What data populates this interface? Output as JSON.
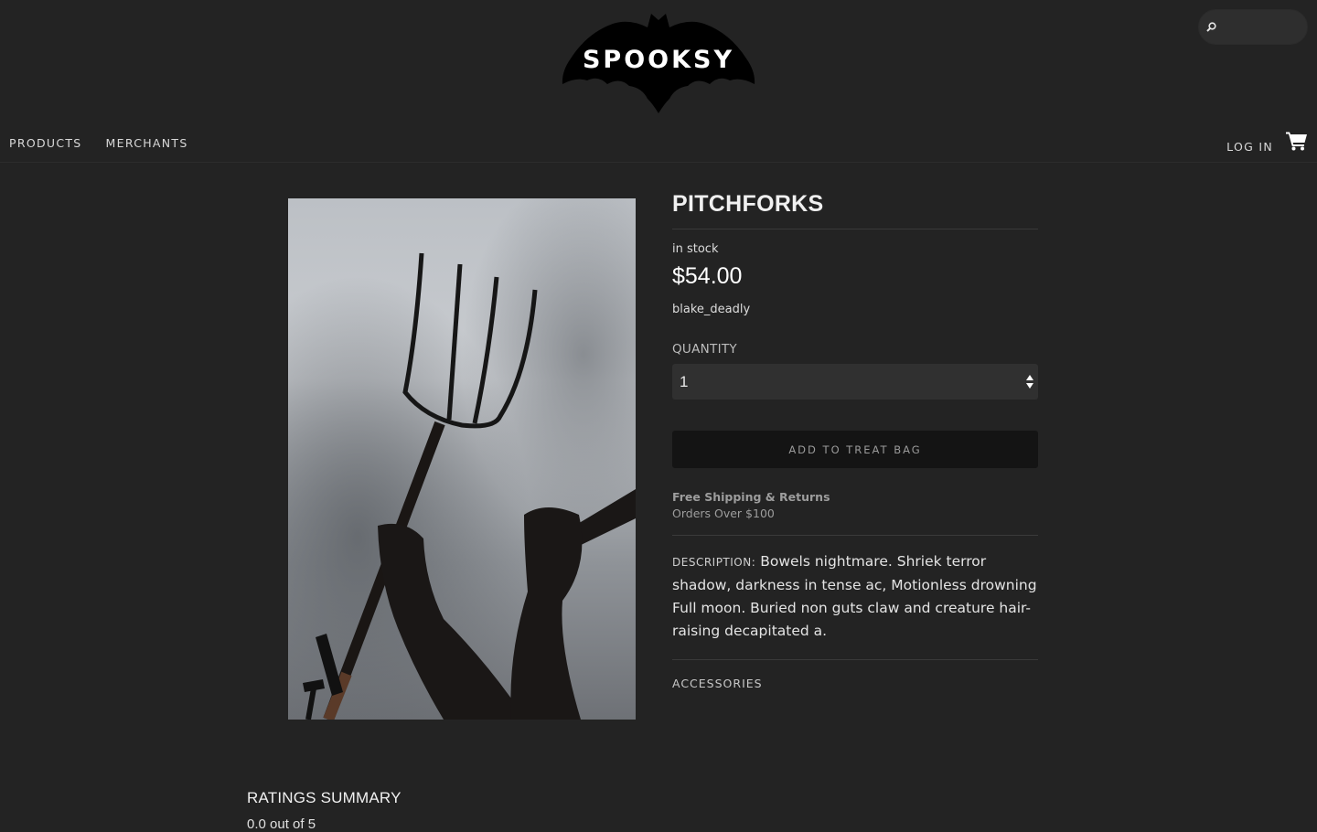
{
  "header": {
    "logo_text": "SPOOKSY",
    "search": {
      "placeholder": ""
    },
    "nav": [
      {
        "label": "PRODUCTS"
      },
      {
        "label": "MERCHANTS"
      }
    ],
    "login_label": "LOG IN",
    "cart_icon": "shopping-cart-icon",
    "search_icon": "search-icon"
  },
  "product": {
    "title": "PITCHFORKS",
    "stock": "in stock",
    "price": "$54.00",
    "merchant": "blake_deadly",
    "quantity_label": "QUANTITY",
    "quantity_value": "1",
    "add_button": "ADD TO TREAT BAG",
    "shipping_title": "Free Shipping & Returns",
    "shipping_sub": "Orders Over $100",
    "description_label": "DESCRIPTION:",
    "description_text": "Bowels nightmare. Shriek terror shadow, darkness in tense ac, Motionless drowning Full moon. Buried non guts claw and creature hair-raising decapitated a.",
    "accessories_label": "ACCESSORIES"
  },
  "ratings": {
    "title": "RATINGS SUMMARY",
    "subtitle": "0.0 out of 5"
  },
  "colors": {
    "background": "#232323",
    "button": "#141414",
    "select": "#303030"
  }
}
